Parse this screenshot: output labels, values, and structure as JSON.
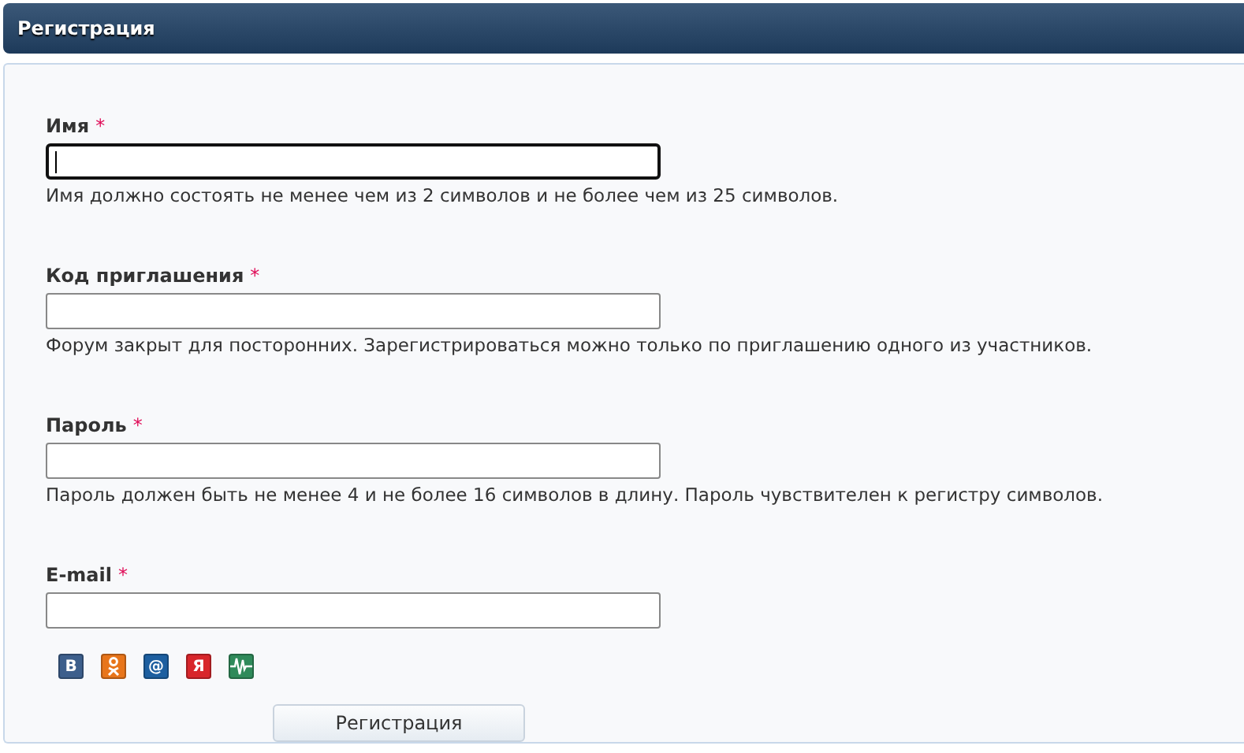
{
  "header": {
    "title": "Регистрация"
  },
  "fields": [
    {
      "label": "Имя",
      "required_mark": "*",
      "focused": true,
      "hint": "Имя должно состоять не менее чем из 2 символов и не более чем из 25 символов."
    },
    {
      "label": "Код приглашения",
      "required_mark": "*",
      "focused": false,
      "hint": "Форум закрыт для посторонних. Зарегистрироваться можно только по приглашению одного из участников."
    },
    {
      "label": "Пароль",
      "required_mark": "*",
      "focused": false,
      "hint": "Пароль должен быть не менее 4 и не более 16 символов в длину. Пароль чувствителен к регистру символов."
    },
    {
      "label": "E-mail",
      "required_mark": "*",
      "focused": false
    }
  ],
  "social": [
    {
      "kind": "letter",
      "glyph": "B",
      "color": "#3d5f8c"
    },
    {
      "kind": "person",
      "color": "#e8751a"
    },
    {
      "kind": "letter",
      "glyph": "@",
      "color": "#1d5fa0"
    },
    {
      "kind": "letter",
      "glyph": "Я",
      "color": "#d8262b"
    },
    {
      "kind": "wave",
      "color": "#2f8a5a"
    }
  ],
  "submit": {
    "label": "Регистрация"
  }
}
